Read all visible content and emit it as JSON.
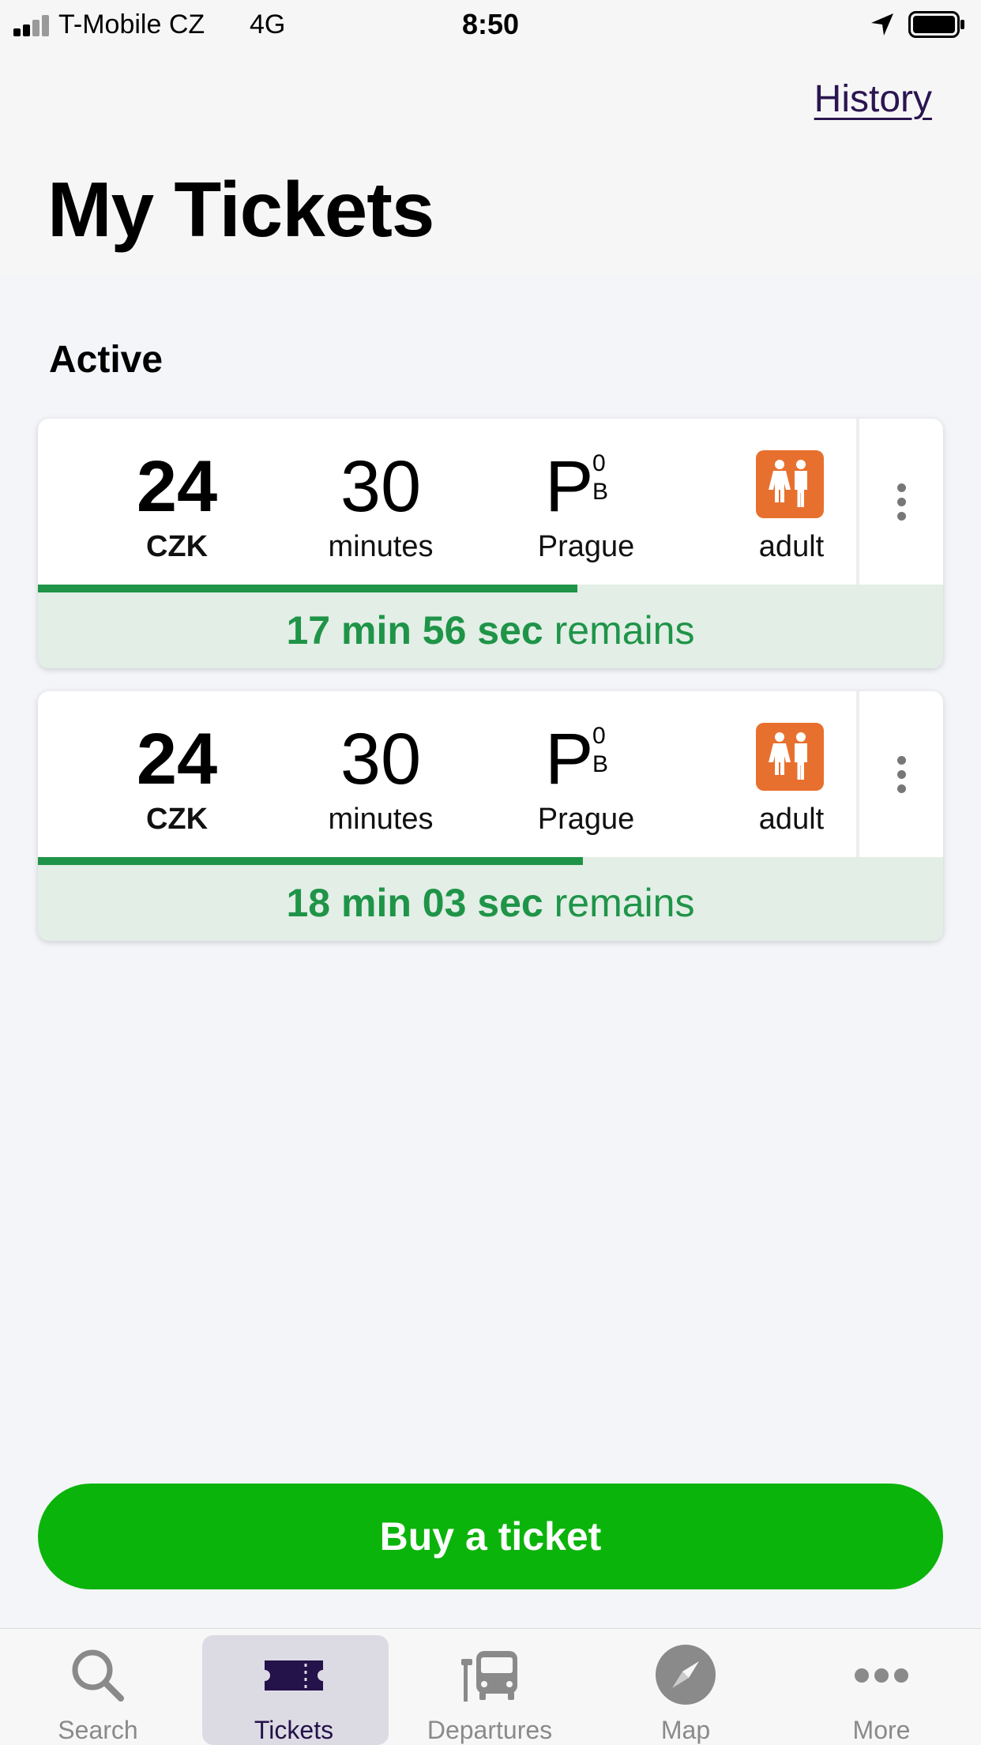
{
  "status_bar": {
    "carrier": "T-Mobile CZ",
    "network": "4G",
    "time": "8:50",
    "icons": [
      "signal-icon",
      "location-arrow-icon",
      "battery-icon"
    ]
  },
  "header": {
    "history_label": "History",
    "title": "My Tickets"
  },
  "section": {
    "active_label": "Active"
  },
  "tickets": [
    {
      "price": "24",
      "currency": "CZK",
      "duration": "30",
      "duration_unit": "minutes",
      "zone_letter": "P",
      "zone_sup": "0",
      "zone_sub": "B",
      "zone_city": "Prague",
      "fare_type": "adult",
      "fare_icon": "adult-pair-icon",
      "remaining_bold": "17 min 56 sec",
      "remaining_suffix": "remains",
      "progress_fraction": 0.596
    },
    {
      "price": "24",
      "currency": "CZK",
      "duration": "30",
      "duration_unit": "minutes",
      "zone_letter": "P",
      "zone_sup": "0",
      "zone_sub": "B",
      "zone_city": "Prague",
      "fare_type": "adult",
      "fare_icon": "adult-pair-icon",
      "remaining_bold": "18 min 03 sec",
      "remaining_suffix": "remains",
      "progress_fraction": 0.602
    }
  ],
  "actions": {
    "buy_label": "Buy a ticket"
  },
  "tab_bar": {
    "tabs": [
      {
        "label": "Search",
        "icon": "search-icon",
        "active": false
      },
      {
        "label": "Tickets",
        "icon": "ticket-icon",
        "active": true
      },
      {
        "label": "Departures",
        "icon": "bus-stop-icon",
        "active": false
      },
      {
        "label": "Map",
        "icon": "compass-icon",
        "active": false
      },
      {
        "label": "More",
        "icon": "more-dots-icon",
        "active": false
      }
    ]
  },
  "colors": {
    "accent_green": "#0bb40b",
    "timer_green": "#1f9448",
    "adult_badge": "#e8702e",
    "active_tab": "#24124a"
  }
}
